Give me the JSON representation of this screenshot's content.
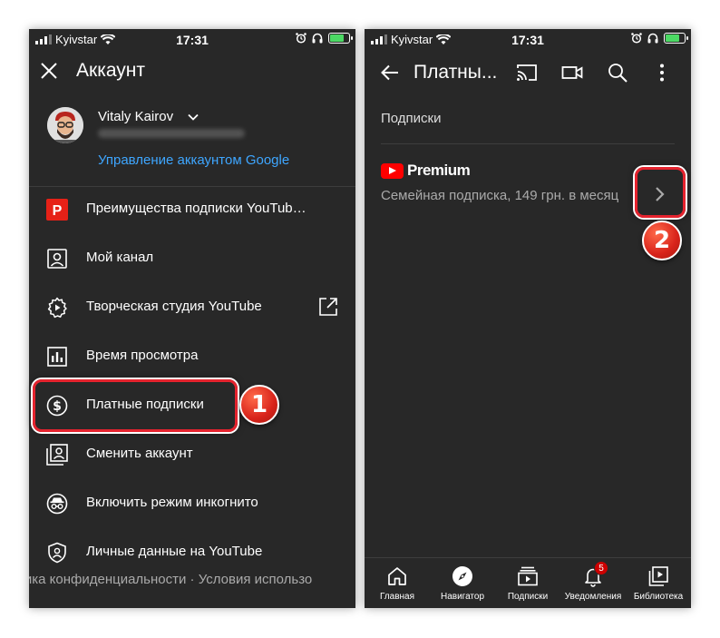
{
  "status_bar": {
    "carrier": "Kyivstar",
    "time": "17:31"
  },
  "left_screen": {
    "title": "Аккаунт",
    "profile": {
      "name": "Vitaly Kairov",
      "manage_link": "Управление аккаунтом Google"
    },
    "menu": [
      {
        "label": "Преимущества подписки YouTub…",
        "icon": "youtube-premium-p-icon"
      },
      {
        "label": "Мой канал",
        "icon": "person-icon"
      },
      {
        "label": "Творческая студия YouTube",
        "icon": "studio-gear-icon"
      },
      {
        "label": "Время просмотра",
        "icon": "bar-chart-icon"
      },
      {
        "label": "Платные подписки",
        "icon": "dollar-icon"
      },
      {
        "label": "Сменить аккаунт",
        "icon": "switch-account-icon"
      },
      {
        "label": "Включить режим инкогнито",
        "icon": "incognito-icon"
      },
      {
        "label": "Личные данные на YouTube",
        "icon": "shield-person-icon"
      }
    ],
    "footer": "тика конфиденциальности  ·  Условия использо"
  },
  "right_screen": {
    "title": "Платны...",
    "section_title": "Подписки",
    "subscription": {
      "brand": "Premium",
      "description": "Семейная подписка, 149 грн. в месяц"
    },
    "bottom_nav": [
      {
        "label": "Главная",
        "icon": "home-icon"
      },
      {
        "label": "Навигатор",
        "icon": "compass-icon"
      },
      {
        "label": "Подписки",
        "icon": "subscriptions-icon"
      },
      {
        "label": "Уведомления",
        "icon": "bell-icon",
        "badge": "5"
      },
      {
        "label": "Библиотека",
        "icon": "library-icon"
      }
    ]
  },
  "annotations": {
    "step1": "1",
    "step2": "2"
  },
  "colors": {
    "background": "#282828",
    "link": "#3ea6ff",
    "accent_red": "#e5232e",
    "youtube_red": "#ff0000"
  }
}
